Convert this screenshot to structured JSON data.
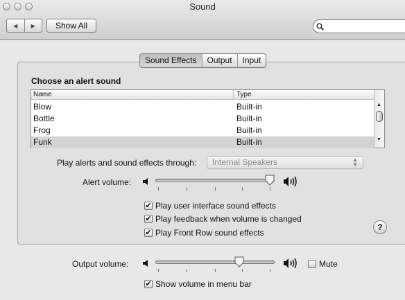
{
  "window": {
    "title": "Sound"
  },
  "toolbar": {
    "show_all_label": "Show All",
    "search_value": ""
  },
  "tabs": [
    {
      "label": "Sound Effects",
      "selected": true
    },
    {
      "label": "Output",
      "selected": false
    },
    {
      "label": "Input",
      "selected": false
    }
  ],
  "sound_effects": {
    "heading": "Choose an alert sound",
    "columns": {
      "name": "Name",
      "type": "Type"
    },
    "rows": [
      {
        "name": "Blow",
        "type": "Built-in"
      },
      {
        "name": "Bottle",
        "type": "Built-in"
      },
      {
        "name": "Frog",
        "type": "Built-in"
      },
      {
        "name": "Funk",
        "type": "Built-in"
      }
    ],
    "selected_row": "Funk",
    "play_through_label": "Play alerts and sound effects through:",
    "play_through_value": "Internal Speakers",
    "alert_volume_label": "Alert volume:",
    "alert_volume_level": 1.0,
    "checkboxes": [
      {
        "label": "Play user interface sound effects",
        "checked": true
      },
      {
        "label": "Play feedback when volume is changed",
        "checked": true
      },
      {
        "label": "Play Front Row sound effects",
        "checked": true
      }
    ],
    "help_label": "?"
  },
  "output": {
    "volume_label": "Output volume:",
    "volume_level": 0.72,
    "mute_label": "Mute",
    "mute_checked": false,
    "show_in_menu_label": "Show volume in menu bar",
    "show_in_menu_checked": true
  }
}
